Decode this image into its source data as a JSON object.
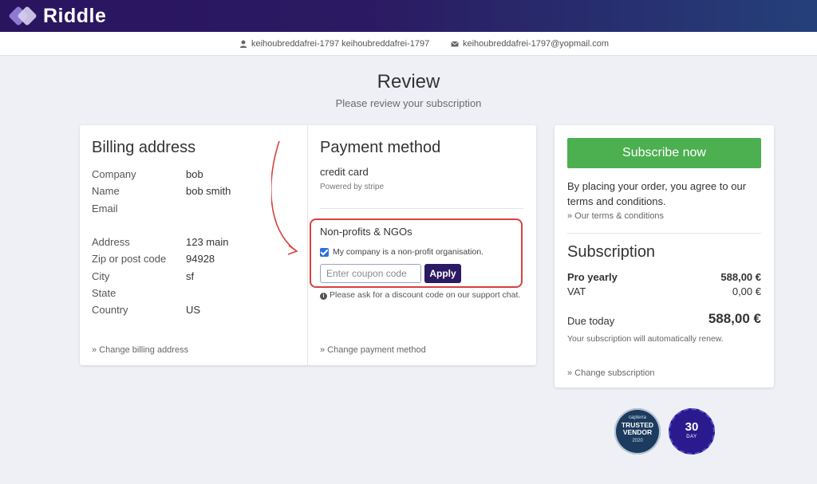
{
  "app": {
    "logo_text": "Riddle"
  },
  "userbar": {
    "username": "keihoubreddafrei-1797 keihoubreddafrei-1797",
    "email": "keihoubreddafrei-1797@yopmail.com"
  },
  "page": {
    "title": "Review",
    "subtitle": "Please review your subscription"
  },
  "billing": {
    "title": "Billing address",
    "rows": [
      {
        "label": "Company",
        "value": "bob"
      },
      {
        "label": "Name",
        "value": "bob smith"
      },
      {
        "label": "Email",
        "value": ""
      },
      {
        "label": "Address",
        "value": "123 main"
      },
      {
        "label": "Zip or post code",
        "value": "94928"
      },
      {
        "label": "City",
        "value": "sf"
      },
      {
        "label": "State",
        "value": ""
      },
      {
        "label": "Country",
        "value": "US"
      }
    ],
    "change_link": "» Change billing address"
  },
  "payment": {
    "title": "Payment method",
    "type": "credit card",
    "powered_by": "Powered by stripe",
    "ngo": {
      "title": "Non-profits & NGOs",
      "checkbox_label": "My company is a non-profit organisation.",
      "checked": true,
      "coupon_placeholder": "Enter coupon code",
      "apply_label": "Apply"
    },
    "discount_note": "Please ask for a discount code on our support chat.",
    "change_link": "» Change payment method"
  },
  "summary": {
    "subscribe_label": "Subscribe now",
    "terms_text": "By placing your order, you agree to our terms and conditions.",
    "terms_link": "» Our terms & conditions",
    "title": "Subscription",
    "lines": [
      {
        "label": "Pro yearly",
        "amount": "588,00 €"
      },
      {
        "label": "VAT",
        "amount": "0,00 €"
      }
    ],
    "due_label": "Due today",
    "due_amount": "588,00 €",
    "renew_note": "Your subscription will automatically renew.",
    "change_link": "» Change subscription"
  },
  "badges": {
    "trusted": {
      "line1": "capterra",
      "line2a": "TRUSTED",
      "line2b": "VENDOR",
      "line3": "2020"
    },
    "money_back": {
      "number": "30",
      "text": "DAY"
    }
  },
  "colors": {
    "topbar": "#2b1a63",
    "subscribe": "#4caf50",
    "apply": "#2b1a63",
    "highlight": "#d8413f"
  }
}
